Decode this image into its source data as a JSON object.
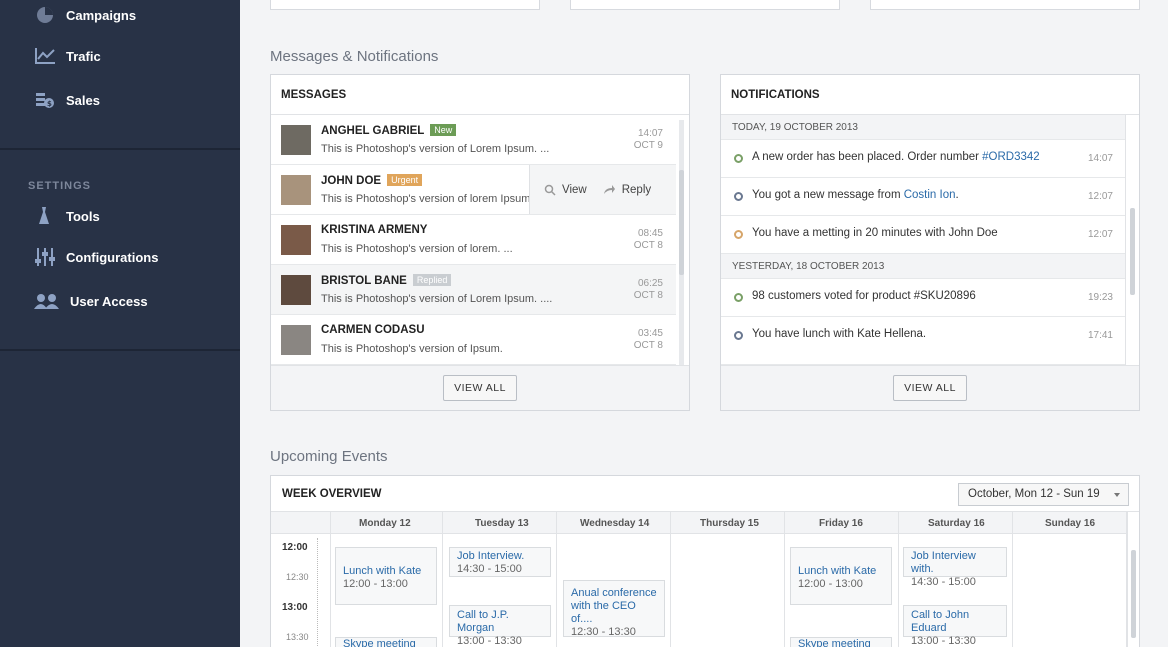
{
  "sidebar": {
    "items": [
      {
        "label": "Campaigns",
        "icon": "pie-chart-icon"
      },
      {
        "label": "Trafic",
        "icon": "line-chart-icon"
      },
      {
        "label": "Sales",
        "icon": "coins-icon"
      }
    ],
    "settings_heading": "SETTINGS",
    "settings_items": [
      {
        "label": "Tools",
        "icon": "tools-icon"
      },
      {
        "label": "Configurations",
        "icon": "sliders-icon"
      },
      {
        "label": "User Access",
        "icon": "users-icon"
      }
    ]
  },
  "messages_section": {
    "title": "Messages & Notifications",
    "messages": {
      "header": "MESSAGES",
      "items": [
        {
          "name": "ANGHEL GABRIEL",
          "badge": "New",
          "badge_color": "#6c9c56",
          "text": "This is Photoshop's version  of Lorem Ipsum. ...",
          "time": "14:07",
          "date": "OCT 9"
        },
        {
          "name": "JOHN DOE",
          "badge": "Urgent",
          "badge_color": "#e0a55b",
          "text": "This is Photoshop's version  of lorem Ipsum",
          "time": "",
          "date": ""
        },
        {
          "name": "KRISTINA ARMENY",
          "badge": "",
          "badge_color": "",
          "text": "This is Photoshop's version  of lorem. ...",
          "time": "08:45",
          "date": "OCT 8"
        },
        {
          "name": "BRISTOL BANE",
          "badge": "Replied",
          "badge_color": "#c9cdd1",
          "text": "This is Photoshop's version  of Lorem Ipsum. ....",
          "time": "06:25",
          "date": "OCT 8"
        },
        {
          "name": "CARMEN CODASU",
          "badge": "",
          "badge_color": "",
          "text": "This is Photoshop's version  of Ipsum.",
          "time": "03:45",
          "date": "OCT 8"
        }
      ],
      "row_actions": {
        "view": "View",
        "reply": "Reply"
      },
      "view_all": "VIEW ALL"
    },
    "notifications": {
      "header": "NOTIFICATIONS",
      "groups": [
        {
          "day": "TODAY, 19 OCTOBER 2013",
          "items": [
            {
              "text": "A new order has been placed. Order number ",
              "link": "#ORD3342",
              "after": "",
              "time": "14:07",
              "dot": "#7aa067"
            },
            {
              "text": "You got a new message from ",
              "link": "Costin Ion",
              "after": ".",
              "time": "12:07",
              "dot": "#6a7890"
            },
            {
              "text": "You have a metting in 20 minutes with John Doe",
              "link": "",
              "after": "",
              "time": "12:07",
              "dot": "#d6a56a"
            }
          ]
        },
        {
          "day": "YESTERDAY, 18 OCTOBER 2013",
          "items": [
            {
              "text": "98 customers voted for product #SKU20896",
              "link": "",
              "after": "",
              "time": "19:23",
              "dot": "#7aa067"
            },
            {
              "text": "You have lunch with Kate Hellena.",
              "link": "",
              "after": "",
              "time": "17:41",
              "dot": "#6a7890"
            }
          ]
        }
      ],
      "view_all": "VIEW ALL"
    }
  },
  "events_section": {
    "title": "Upcoming Events",
    "week_header": "WEEK OVERVIEW",
    "week_select": "October, Mon 12 - Sun 19",
    "days": [
      "Monday 12",
      "Tuesday 13",
      "Wednesday 14",
      "Thursday 15",
      "Friday 16",
      "Saturday 16",
      "Sunday 16"
    ],
    "hours": [
      "12:00",
      "12:30",
      "13:00",
      "13:30"
    ],
    "events": [
      {
        "title": "Lunch with Kate",
        "time": "12:00 - 13:00"
      },
      {
        "title": "Skype meeting",
        "time": ""
      },
      {
        "title": "Job Interview.",
        "time": "14:30 - 15:00"
      },
      {
        "title": "Call to J.P. Morgan",
        "time": "13:00 - 13:30"
      },
      {
        "title": "Anual conference with the CEO of....",
        "time": "12:30 - 13:30"
      },
      {
        "title": "Lunch with Kate",
        "time": "12:00 - 13:00"
      },
      {
        "title": "Skype meeting",
        "time": ""
      },
      {
        "title": "Job Interview with.",
        "time": "14:30 - 15:00"
      },
      {
        "title": "Call to John Eduard",
        "time": "13:00 - 13:30"
      }
    ]
  }
}
